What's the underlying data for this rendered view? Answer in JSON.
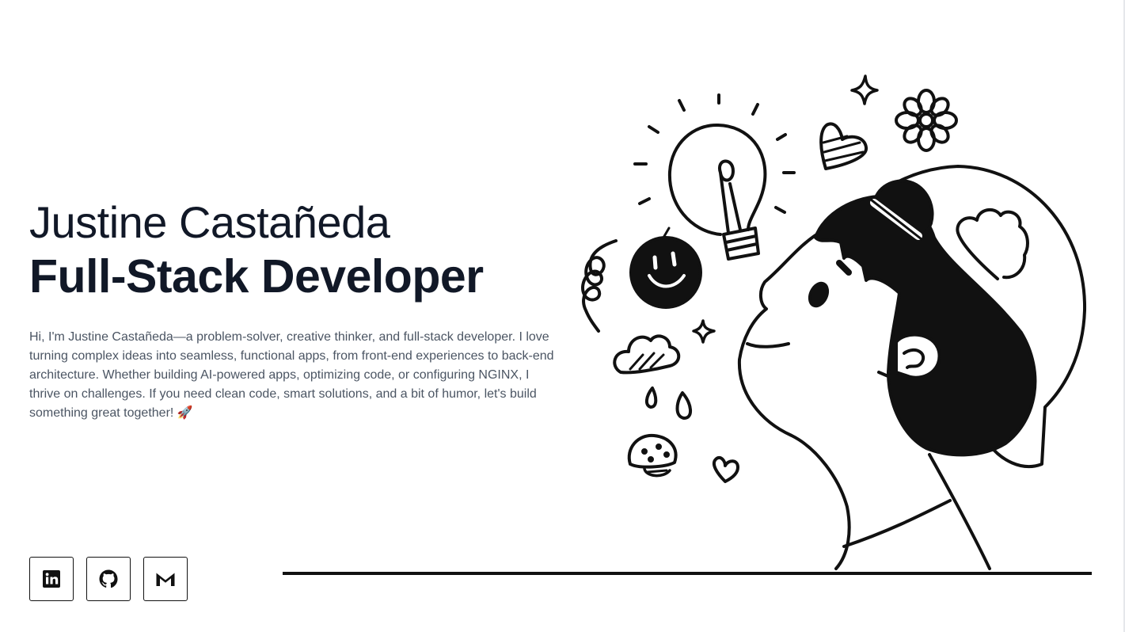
{
  "hero": {
    "name": "Justine Castañeda",
    "role": "Full-Stack Developer",
    "bio": "Hi, I'm Justine Castañeda—a problem-solver, creative thinker, and full-stack developer. I love turning complex ideas into seamless, functional apps, from front-end experiences to back-end architecture. Whether building AI-powered apps, optimizing code, or configuring NGINX, I thrive on challenges. If you need clean code, smart solutions, and a bit of humor, let's build something great together! 🚀"
  },
  "socials": [
    {
      "icon": "linkedin-icon"
    },
    {
      "icon": "github-icon"
    },
    {
      "icon": "gmail-icon"
    }
  ],
  "colors": {
    "heading": "#111827",
    "body_text": "#4b5563",
    "ink": "#111111",
    "background": "#ffffff"
  }
}
